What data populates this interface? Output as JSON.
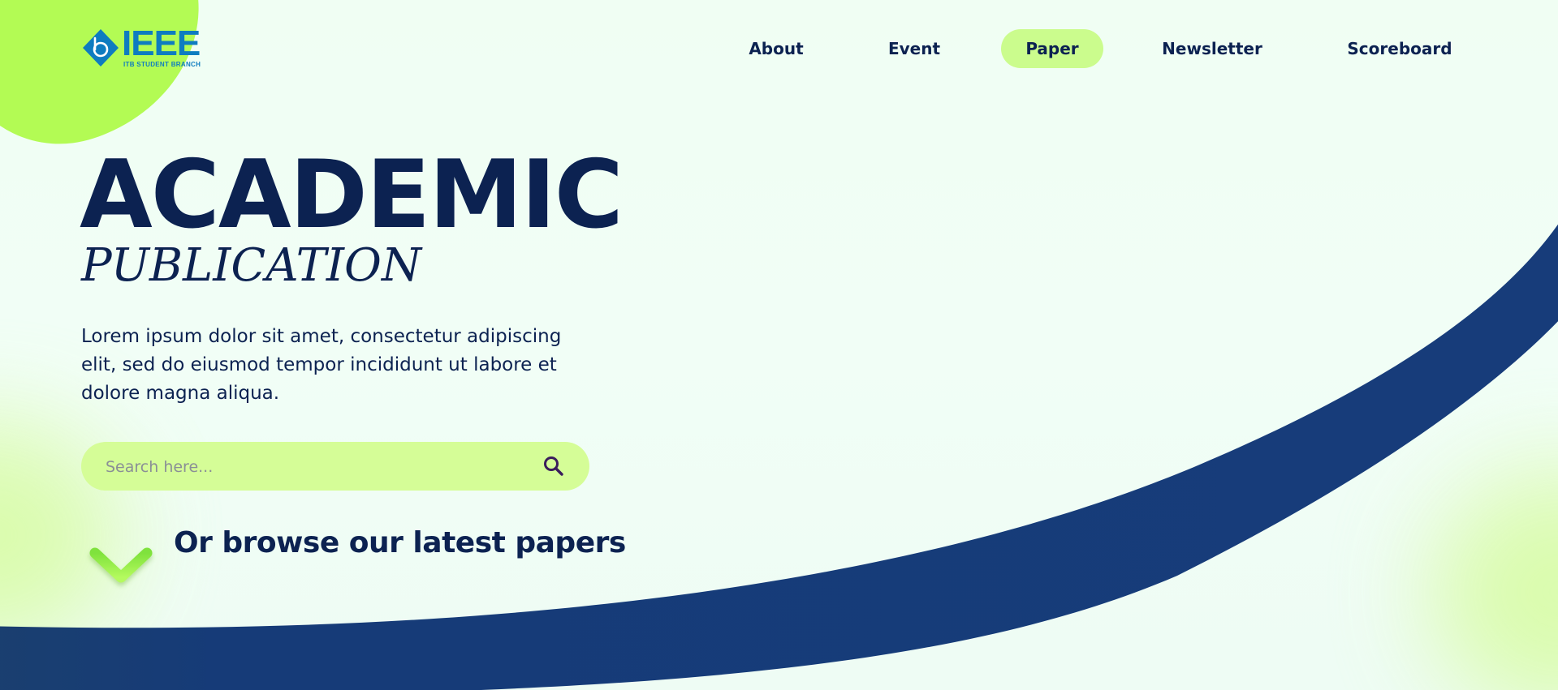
{
  "brand": {
    "name": "IEEE",
    "subtitle": "ITB STUDENT BRANCH",
    "logo_icon": "ieee-diamond-icon",
    "color": "#0e7cc0"
  },
  "nav": {
    "items": [
      {
        "label": "About"
      },
      {
        "label": "Event"
      },
      {
        "label": "Paper",
        "active": true
      },
      {
        "label": "Newsletter"
      },
      {
        "label": "Scoreboard"
      }
    ]
  },
  "hero": {
    "title": "ACADEMIC",
    "subtitle": "PUBLICATION",
    "description": "Lorem ipsum dolor sit amet, consectetur adipiscing elit, sed do eiusmod tempor incididunt ut labore et dolore magna aliqua."
  },
  "search": {
    "placeholder": "Search here...",
    "value": "",
    "icon": "search-icon"
  },
  "browse": {
    "label": "Or browse our latest papers",
    "icon": "arrow-down-icon"
  },
  "colors": {
    "navy": "#0c2251",
    "accent_green": "#b3fb54",
    "pill_green": "#cbfc8d",
    "swoosh": "#173c7a",
    "background": "#eefdf4"
  }
}
